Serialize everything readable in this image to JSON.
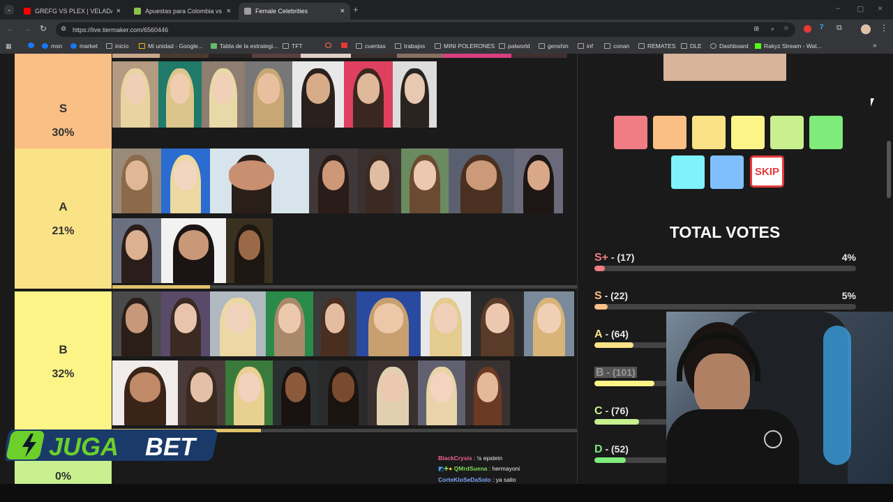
{
  "browser": {
    "tabs": [
      {
        "title": "GREFG VS PLEX | VELADA DEL A",
        "favicon_color": "#ff0000",
        "active": false
      },
      {
        "title": "Apuestas para Colombia vs Fra",
        "favicon_color": "#8bc34a",
        "active": false
      },
      {
        "title": "Female Celebrities",
        "favicon_color": "#9e9e9e",
        "active": true
      }
    ],
    "new_tab_icon": "plus-icon",
    "url": "https://live.tiermaker.com/6560446",
    "bookmarks": [
      {
        "label": "",
        "icon": "facebook-icon"
      },
      {
        "label": "msn",
        "icon": "facebook-icon"
      },
      {
        "label": "market",
        "icon": "facebook-icon"
      },
      {
        "label": "inicio",
        "icon": "folder-icon"
      },
      {
        "label": "Mi unidad - Google...",
        "icon": "drive-icon"
      },
      {
        "label": "Tabla de la estrategi...",
        "icon": "leaf-icon"
      },
      {
        "label": "TFT",
        "icon": "folder-icon"
      },
      {
        "label": "",
        "icon": "orange-circle-icon"
      },
      {
        "label": "",
        "icon": "red-drop-icon"
      },
      {
        "label": "cuentas",
        "icon": "folder-icon"
      },
      {
        "label": "trabajos",
        "icon": "folder-icon"
      },
      {
        "label": "MINI POLERONES",
        "icon": "folder-icon"
      },
      {
        "label": "palworld",
        "icon": "folder-icon"
      },
      {
        "label": "genshin",
        "icon": "folder-icon"
      },
      {
        "label": "inf",
        "icon": "folder-icon"
      },
      {
        "label": "conan",
        "icon": "folder-icon"
      },
      {
        "label": "REMATES",
        "icon": "folder-icon"
      },
      {
        "label": "DLE",
        "icon": "folder-icon"
      },
      {
        "label": "Dashboard",
        "icon": "globe-icon"
      },
      {
        "label": "Rakyz Stream - Wat...",
        "icon": "kick-icon"
      }
    ]
  },
  "tiers": [
    {
      "name": "S",
      "percent": "30%",
      "color": "#f9bf84",
      "progress": 0.3
    },
    {
      "name": "A",
      "percent": "21%",
      "color": "#fae286",
      "progress": 0.21
    },
    {
      "name": "B",
      "percent": "32%",
      "color": "#fcf487",
      "progress": 0.32
    },
    {
      "name": "",
      "percent": "0%",
      "color": "#c8f08f",
      "progress": 0
    }
  ],
  "vote_buttons": {
    "colors": [
      "#f07c84",
      "#f9bf84",
      "#fae286",
      "#fcf487",
      "#c8f08f",
      "#7eeb7a",
      "#7ff2fd",
      "#7fbffd"
    ],
    "skip_label": "SKIP"
  },
  "total_votes": {
    "title": "TOTAL VOTES",
    "rows": [
      {
        "tier": "S+",
        "count": "- (17)",
        "percent": "4%",
        "color": "#f07c84",
        "fraction": 0.04
      },
      {
        "tier": "S",
        "count": "- (22)",
        "percent": "5%",
        "color": "#f9bf84",
        "fraction": 0.05
      },
      {
        "tier": "A",
        "count": "- (64)",
        "percent": "",
        "color": "#fae286",
        "fraction": 0.15
      },
      {
        "tier": "B",
        "count": "- (101)",
        "percent": "",
        "color": "#fcf487",
        "fraction": 0.23
      },
      {
        "tier": "C",
        "count": "- (76)",
        "percent": "",
        "color": "#c8f08f",
        "fraction": 0.17
      },
      {
        "tier": "D",
        "count": "- (52)",
        "percent": "",
        "color": "#7eeb7a",
        "fraction": 0.12
      }
    ]
  },
  "overlay": {
    "logo_text_1": "JUGA",
    "logo_text_2": "BET",
    "chat": [
      {
        "user": "BlackCrysis",
        "color": "#f06292",
        "message": ": !s epstein"
      },
      {
        "user": "QMrdSuena",
        "color": "#7ed957",
        "message": ": hermayoni"
      },
      {
        "user": "CorteKloSeDaSolo",
        "color": "#7ea6ff",
        "message": ": ya salio"
      }
    ]
  }
}
